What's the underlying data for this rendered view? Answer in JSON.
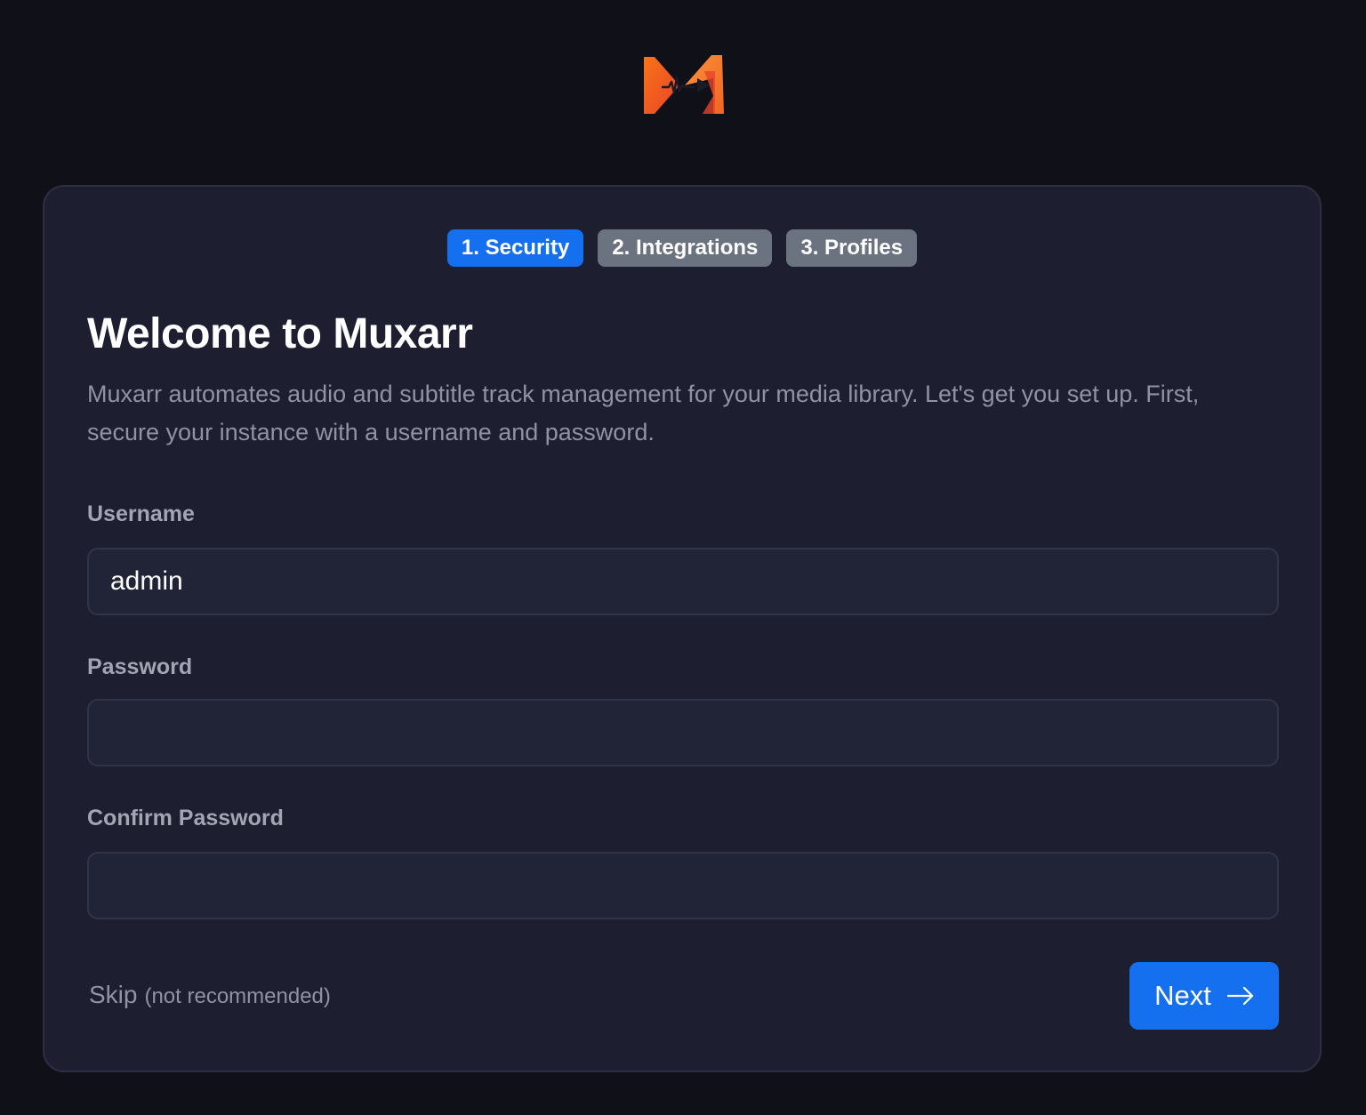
{
  "app": {
    "name": "Muxarr",
    "logo_icon": "muxarr-logo-icon"
  },
  "steps": [
    {
      "label": "1. Security",
      "active": true
    },
    {
      "label": "2. Integrations",
      "active": false
    },
    {
      "label": "3. Profiles",
      "active": false
    }
  ],
  "welcome": {
    "title": "Welcome to Muxarr",
    "description": "Muxarr automates audio and subtitle track management for your media library. Let's get you set up. First, secure your instance with a username and password."
  },
  "form": {
    "username": {
      "label": "Username",
      "value": "admin",
      "placeholder": ""
    },
    "password": {
      "label": "Password",
      "value": "",
      "placeholder": ""
    },
    "confirm_password": {
      "label": "Confirm Password",
      "value": "",
      "placeholder": ""
    }
  },
  "actions": {
    "skip_label": "Skip",
    "skip_note": "(not recommended)",
    "next_label": "Next",
    "next_icon": "arrow-right-icon"
  },
  "colors": {
    "background": "#101019",
    "card": "#1d1e30",
    "accent": "#1570ef",
    "step_inactive": "#6b7280",
    "logo_orange": "#f97316",
    "logo_red": "#ef4444"
  }
}
